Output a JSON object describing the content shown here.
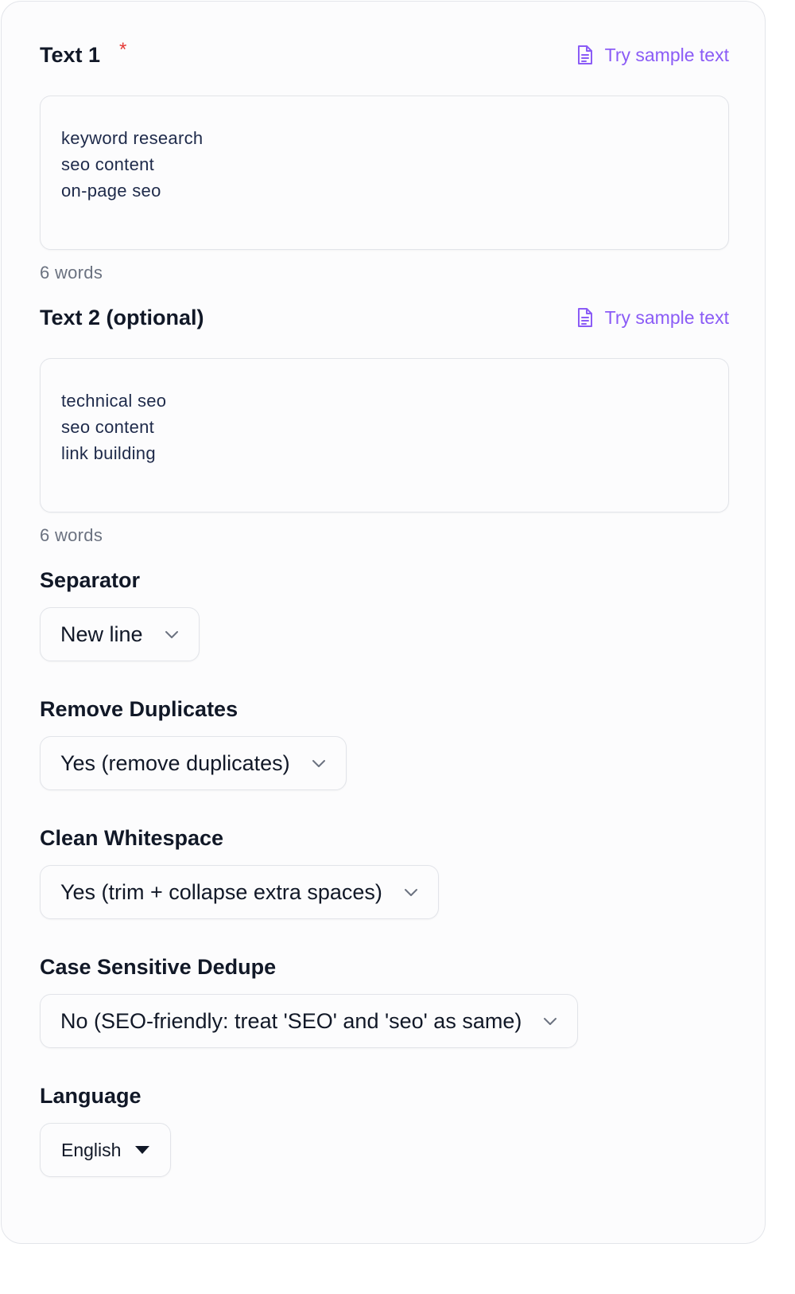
{
  "text1": {
    "label": "Text 1",
    "required_mark": "*",
    "sample_link": "Try sample text",
    "lines": [
      "keyword research",
      "seo content",
      "on-page seo"
    ],
    "word_count": "6 words"
  },
  "text2": {
    "label": "Text 2 (optional)",
    "sample_link": "Try sample text",
    "lines": [
      "technical seo",
      "seo content",
      "link building"
    ],
    "word_count": "6 words"
  },
  "separator": {
    "label": "Separator",
    "value": "New line"
  },
  "remove_duplicates": {
    "label": "Remove Duplicates",
    "value": "Yes (remove duplicates)"
  },
  "clean_whitespace": {
    "label": "Clean Whitespace",
    "value": "Yes (trim + collapse extra spaces)"
  },
  "case_sensitive": {
    "label": "Case Sensitive Dedupe",
    "value": "No (SEO-friendly: treat 'SEO' and 'seo' as same)"
  },
  "language": {
    "label": "Language",
    "value": "English"
  },
  "icons": {
    "sample": "document-icon",
    "dropdown": "chevron-down-icon",
    "language_caret": "caret-down-icon"
  },
  "colors": {
    "accent": "#8b5cf6",
    "required": "#e53935",
    "text": "#111827",
    "input_text": "#1e2a4a",
    "muted": "#6b7280",
    "border": "#e2e4e9"
  }
}
